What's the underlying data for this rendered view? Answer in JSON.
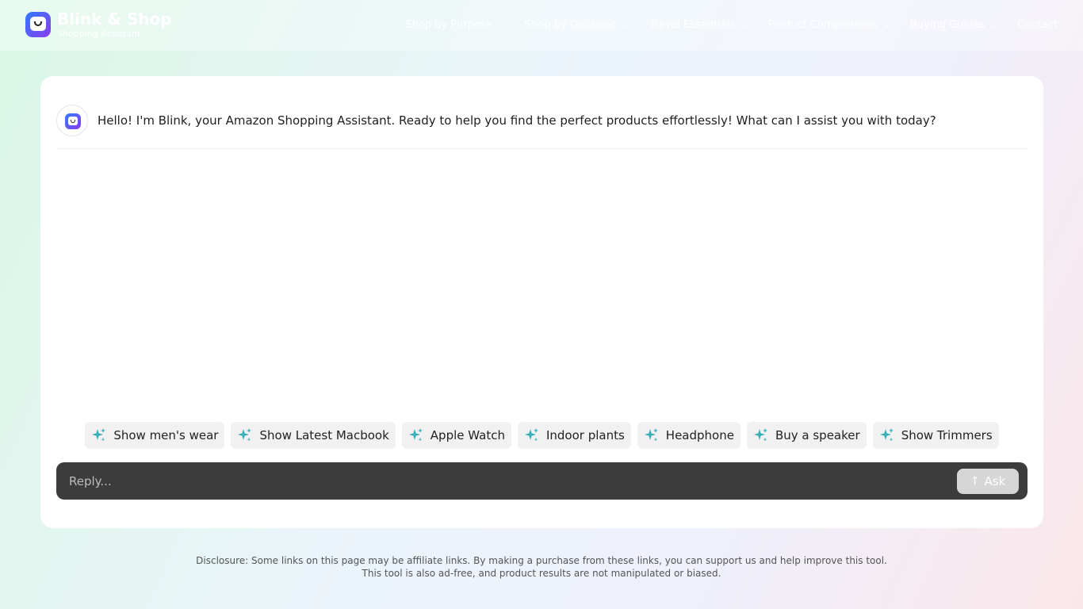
{
  "header": {
    "brand_title": "Blink & Shop",
    "brand_subtitle": "Shopping Assistant",
    "nav": [
      {
        "label": "Shop by Purpose",
        "has_dropdown": true
      },
      {
        "label": "Shop by Occasion",
        "has_dropdown": true
      },
      {
        "label": "Travel Essentials",
        "has_dropdown": true
      },
      {
        "label": "Product Comparisons",
        "has_dropdown": true
      },
      {
        "label": "Buying Guides",
        "has_dropdown": true
      },
      {
        "label": "Contact",
        "has_dropdown": false
      }
    ],
    "chevron": "⌄"
  },
  "chat": {
    "greeting": "Hello! I'm Blink, your Amazon Shopping Assistant. Ready to help you find the perfect products effortlessly! What can I assist you with today?"
  },
  "suggestions": [
    "Show men's wear",
    "Show Latest Macbook",
    "Apple Watch",
    "Indoor plants",
    "Headphone",
    "Buy a speaker",
    "Show Trimmers"
  ],
  "reply": {
    "placeholder": "Reply...",
    "ask_label": "Ask",
    "ask_icon": "↑"
  },
  "disclosure": {
    "line1": "Disclosure: Some links on this page may be affiliate links. By making a purchase from these links, you can support us and help improve this tool.",
    "line2": "This tool is also ad-free, and product results are not manipulated or biased."
  },
  "colors": {
    "accent_sparkle": "#3aaeb6",
    "logo_start": "#2f7bff",
    "logo_end": "#8a3cf0",
    "reply_bg": "#3c3c3c"
  }
}
